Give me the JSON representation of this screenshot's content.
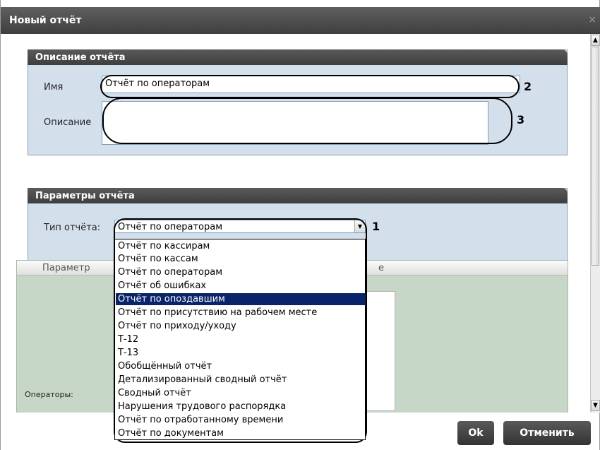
{
  "window": {
    "title": "Новый отчёт",
    "close_glyph": "×"
  },
  "description_group": {
    "title": "Описание отчёта",
    "name_label": "Имя",
    "name_value": "Отчёт по операторам",
    "description_label": "Описание",
    "description_value": ""
  },
  "params_group": {
    "title": "Параметры отчёта",
    "type_label": "Тип отчёта:",
    "type_value": "Отчёт по операторам",
    "table_header_param": "Параметр",
    "table_header_value_suffix": "е",
    "operators_label": "Операторы:"
  },
  "dropdown": {
    "items": [
      "Отчёт по кассирам",
      "Отчёт по кассам",
      "Отчёт по операторам",
      "Отчёт об ошибках",
      "Отчёт по опоздавшим",
      "Отчёт по присутствию на рабочем месте",
      "Отчёт по приходу/уходу",
      "Т-12",
      "Т-13",
      "Обобщённый отчёт",
      "Детализированный сводный отчёт",
      "Сводный отчёт",
      "Нарушения трудового распорядка",
      "Отчёт по отработанному времени",
      "Отчёт по документам"
    ],
    "selected": "Отчёт по опоздавшим"
  },
  "callouts": {
    "one": "1",
    "two": "2",
    "three": "3"
  },
  "buttons": {
    "ok": "Ok",
    "cancel": "Отменить"
  },
  "icons": {
    "dropdown_arrow": "chevron-down-icon",
    "close": "close-icon",
    "scroll_up": "arrow-up-icon",
    "scroll_down": "arrow-down-icon"
  },
  "colors": {
    "selection": "#0a246a",
    "group_bg": "#d4dfec",
    "header_bg": "#444444"
  }
}
